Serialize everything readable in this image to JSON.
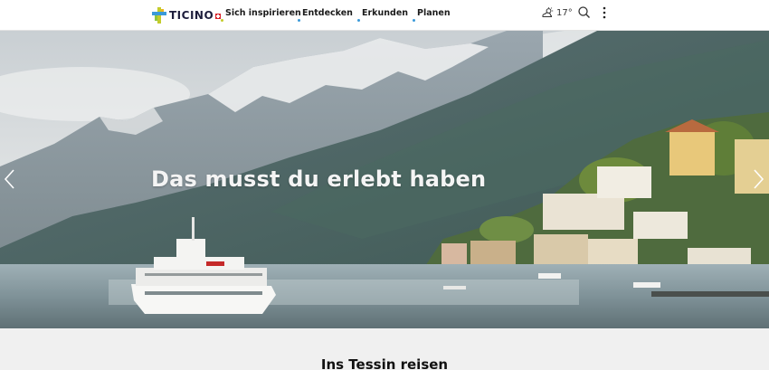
{
  "header": {
    "logo_text": "TICINO",
    "nav": [
      {
        "label": "Sich inspirieren",
        "dot_color": "#c4cc2b"
      },
      {
        "label": "Entdecken",
        "dot_color": "#3a9ad9"
      },
      {
        "label": "Erkunden",
        "dot_color": "#3a9ad9"
      },
      {
        "label": "Planen",
        "dot_color": "#3a9ad9"
      }
    ],
    "weather": {
      "icon": "weather-cloud-sun-icon",
      "temperature": "17°"
    },
    "search_icon": "search-icon",
    "more_icon": "more-vertical-icon"
  },
  "hero": {
    "title": "Das musst du erlebt haben",
    "prev_icon": "chevron-left-icon",
    "next_icon": "chevron-right-icon"
  },
  "section": {
    "title": "Ins Tessin reisen"
  },
  "colors": {
    "brand_yellow": "#c4cc2b",
    "brand_blue": "#3a9ad9",
    "brand_red": "#d8232a",
    "logo_text": "#1e1e3c"
  }
}
